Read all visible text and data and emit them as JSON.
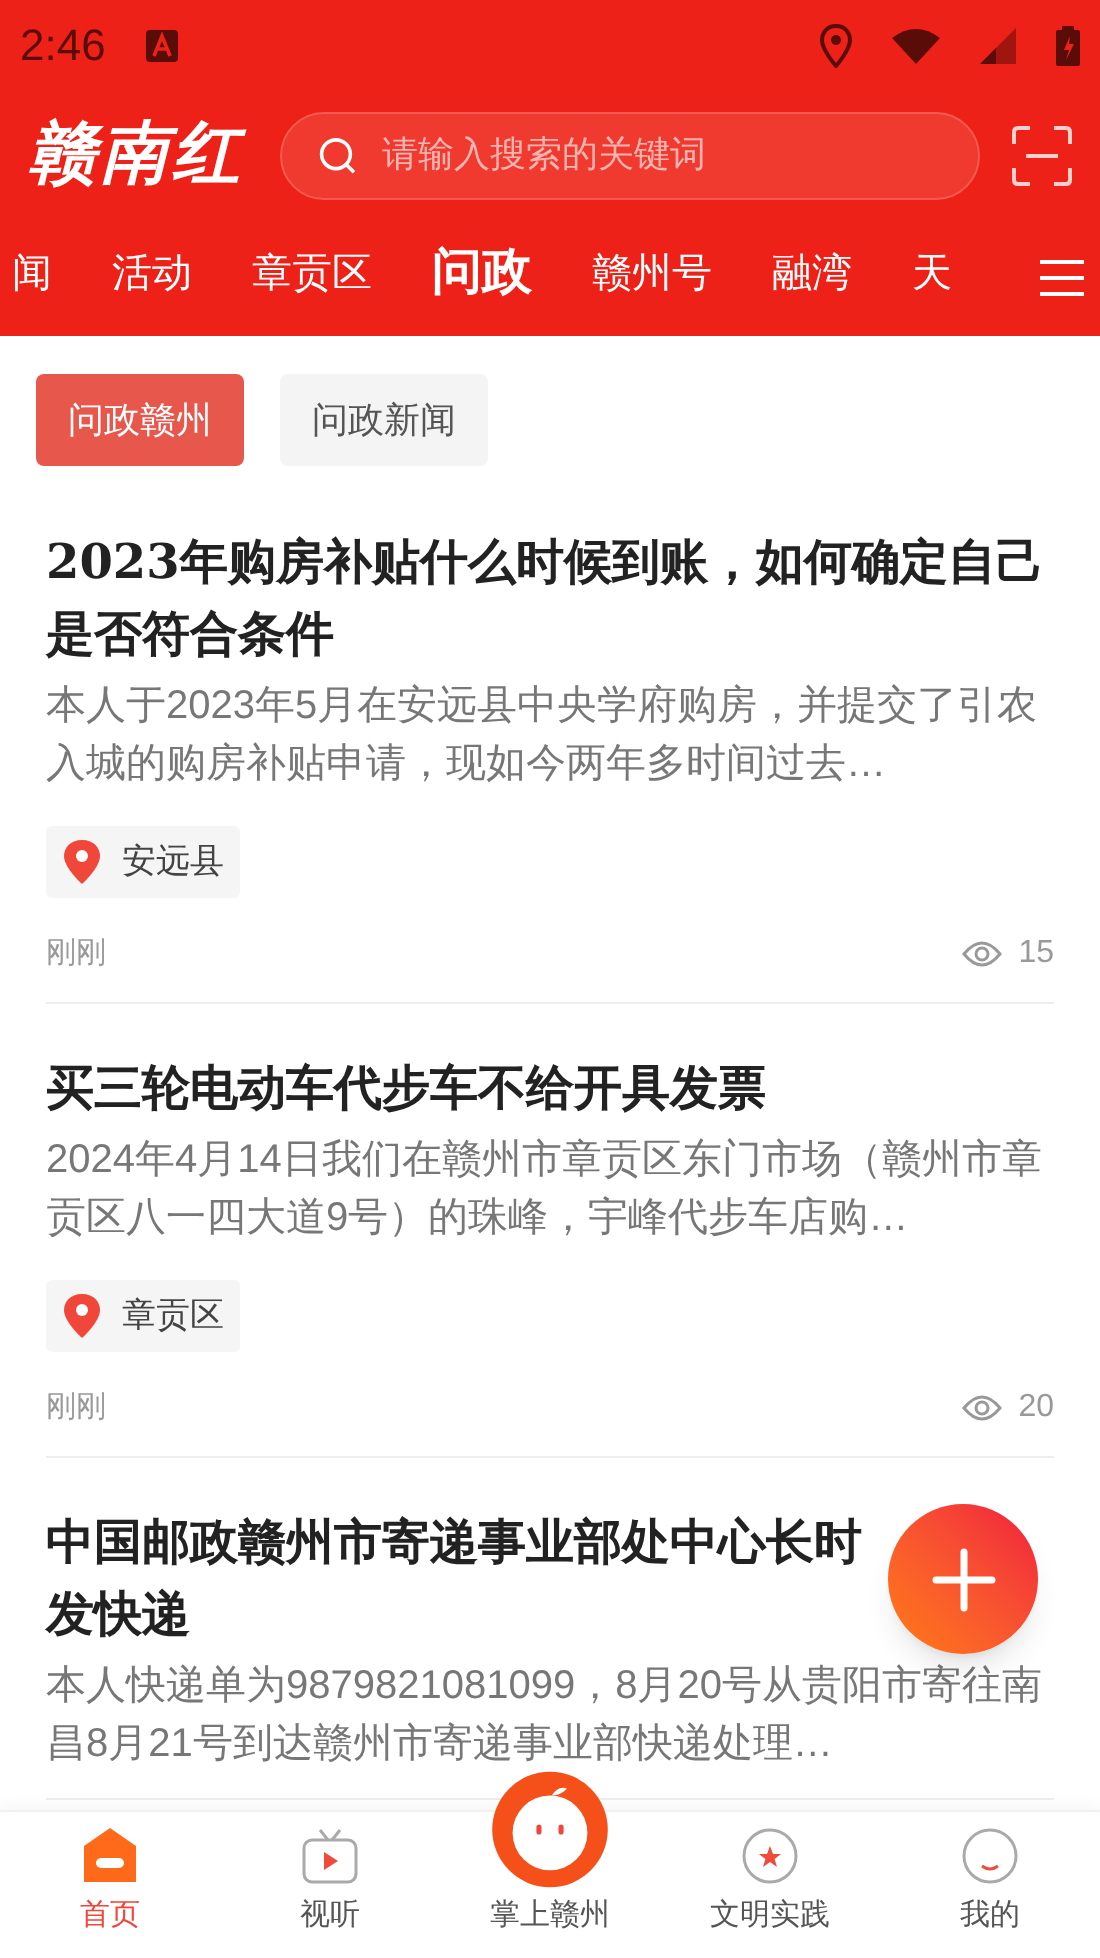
{
  "status_bar": {
    "time": "2:46"
  },
  "header": {
    "logo": "赣南红",
    "search": {
      "placeholder": "请输入搜索的关键词"
    }
  },
  "tabs": [
    {
      "label": "闻",
      "selected": false
    },
    {
      "label": "活动",
      "selected": false
    },
    {
      "label": "章贡区",
      "selected": false
    },
    {
      "label": "问政",
      "selected": true
    },
    {
      "label": "赣州号",
      "selected": false
    },
    {
      "label": "融湾",
      "selected": false
    },
    {
      "label": "天",
      "selected": false
    }
  ],
  "filters": [
    {
      "label": "问政赣州",
      "selected": true
    },
    {
      "label": "问政新闻",
      "selected": false
    }
  ],
  "articles": [
    {
      "title": "2023年购房补贴什么时候到账，如何确定自己是否符合条件",
      "summary": "本人于2023年5月在安远县中央学府购房，并提交了引农入城的购房补贴申请，现如今两年多时间过去…",
      "location": "安远县",
      "time": "刚刚",
      "views": "15"
    },
    {
      "title": "买三轮电动车代步车不给开具发票",
      "summary": "2024年4月14日我们在赣州市章贡区东门市场（赣州市章贡区八一四大道9号）的珠峰，宇峰代步车店购…",
      "location": "章贡区",
      "time": "刚刚",
      "views": "20"
    },
    {
      "title_lines": [
        "中国邮政赣州市寄递事业部处中心长时",
        "发快递"
      ],
      "summary": "本人快递单为9879821081099，8月20号从贵阳市寄往南昌8月21号到达赣州市寄递事业部快递处理…"
    }
  ],
  "bottom_nav": [
    {
      "label": "首页",
      "selected": true,
      "kind": "home"
    },
    {
      "label": "视听",
      "selected": false,
      "kind": "tv"
    },
    {
      "label": "掌上赣州",
      "selected": false,
      "kind": "center"
    },
    {
      "label": "文明实践",
      "selected": false,
      "kind": "star"
    },
    {
      "label": "我的",
      "selected": false,
      "kind": "me"
    }
  ]
}
